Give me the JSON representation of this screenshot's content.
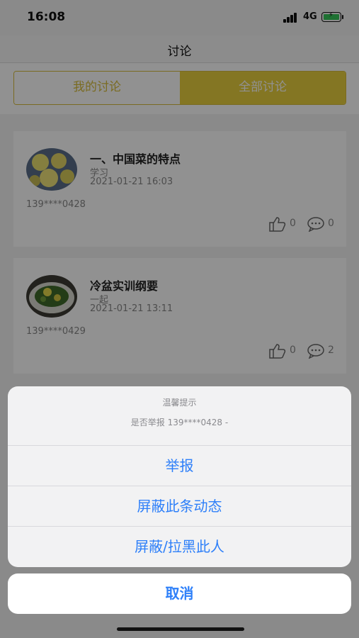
{
  "status": {
    "time": "16:08",
    "network": "4G"
  },
  "nav": {
    "title": "讨论"
  },
  "tabs": [
    {
      "label": "我的讨论",
      "selected": false
    },
    {
      "label": "全部讨论",
      "selected": true
    }
  ],
  "posts": [
    {
      "title": "一、中国菜的特点",
      "category": "学习",
      "date": "2021-01-21 16:03",
      "user": "139****0428",
      "likes": "0",
      "comments": "0"
    },
    {
      "title": "冷盆实训纲要",
      "category": "一起",
      "date": "2021-01-21 13:11",
      "user": "139****0429",
      "likes": "0",
      "comments": "2"
    }
  ],
  "action_sheet": {
    "title": "温馨提示",
    "message": "是否举报 139****0428 -",
    "actions": [
      "举报",
      "屏蔽此条动态",
      "屏蔽/拉黑此人"
    ],
    "cancel": "取消"
  },
  "colors": {
    "accent": "#e8cf3e",
    "action_blue": "#2d7ff9"
  },
  "icons": {
    "like": "thumbs-up-icon",
    "comment": "comment-bubble-icon"
  }
}
